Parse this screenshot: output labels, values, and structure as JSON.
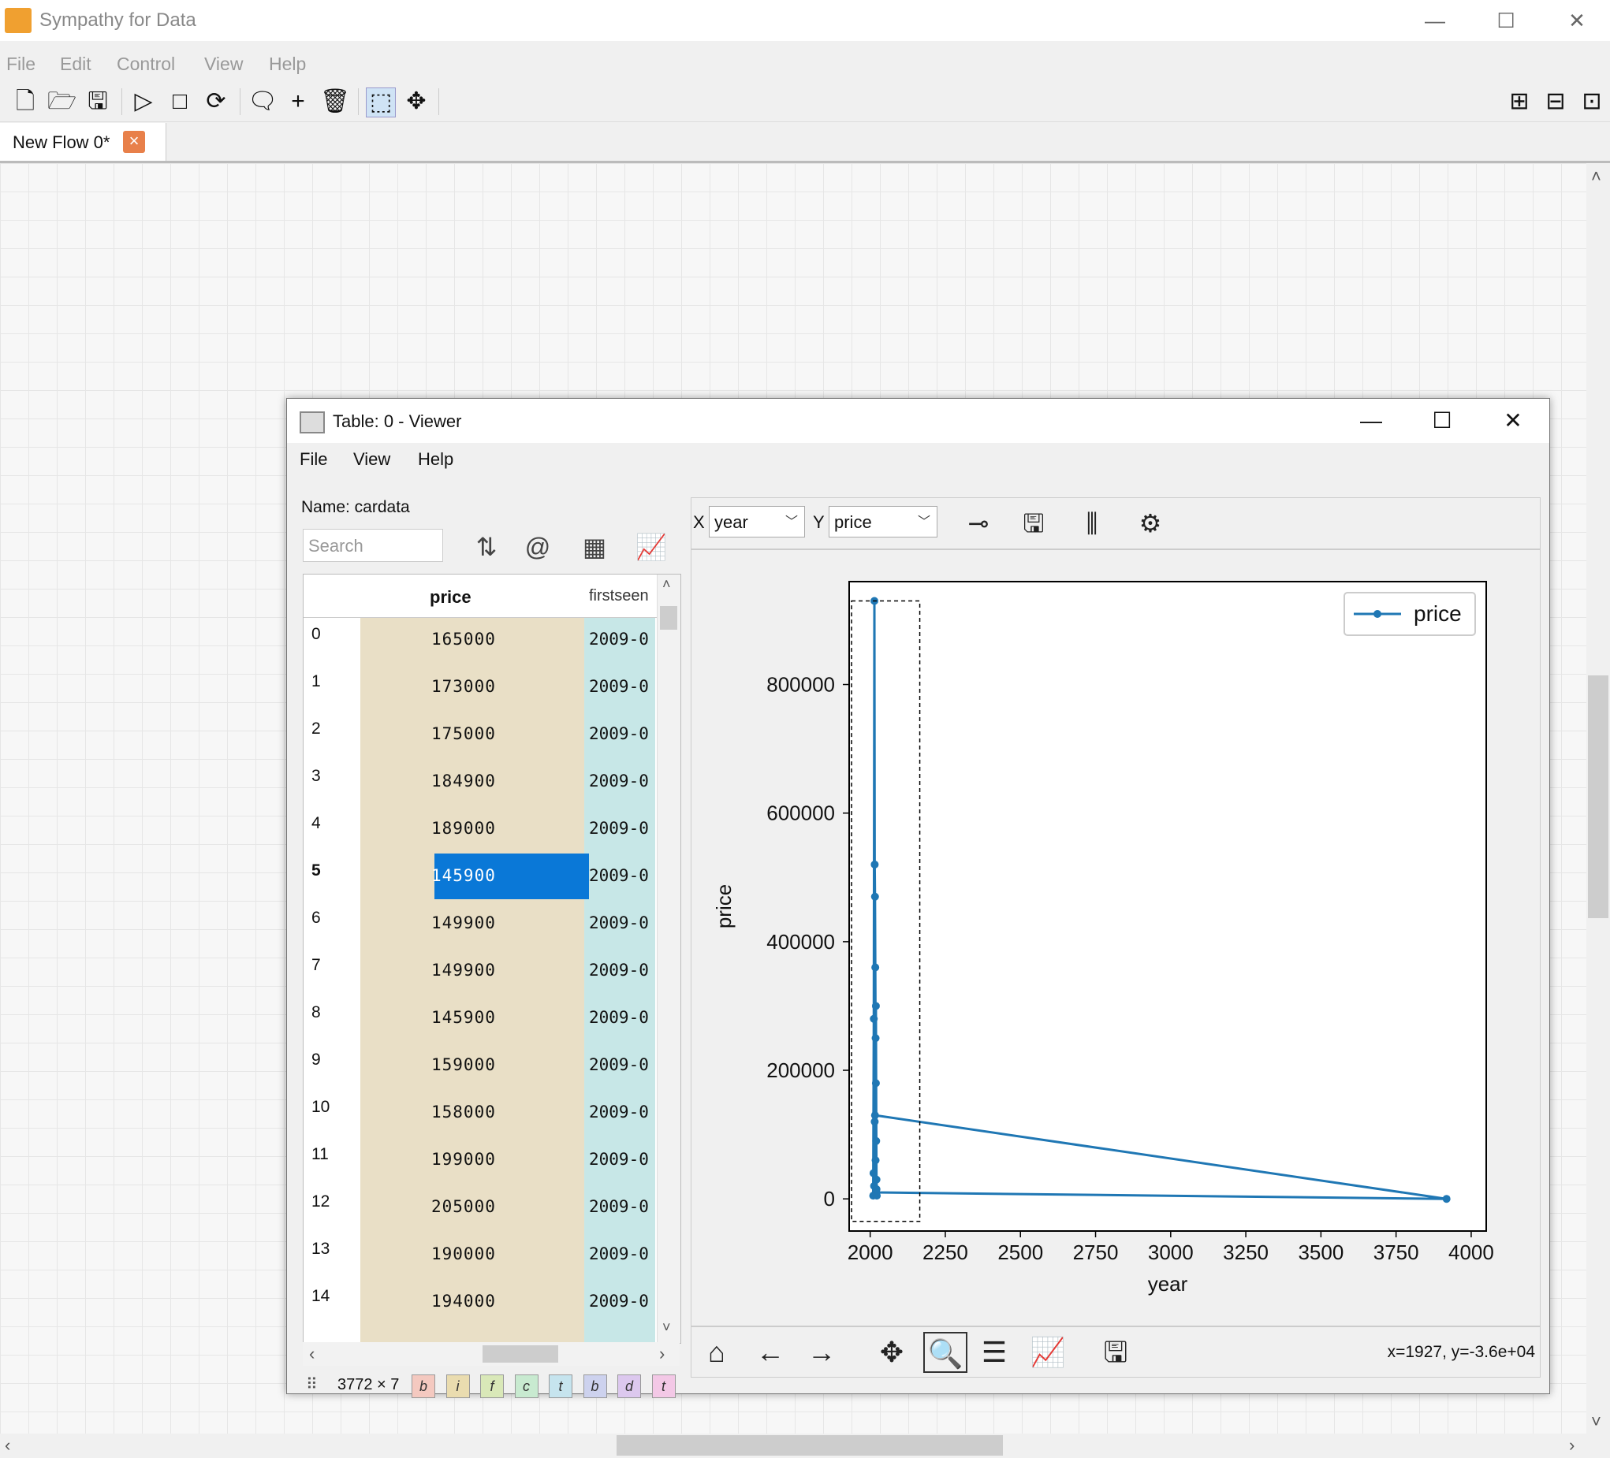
{
  "app": {
    "title": "Sympathy for Data",
    "menus": [
      "File",
      "Edit",
      "Control",
      "View",
      "Help"
    ],
    "tab": {
      "label": "New Flow 0*",
      "close": "×"
    },
    "window_buttons": {
      "minimize": "—",
      "maximize": "☐",
      "close": "✕"
    }
  },
  "viewer": {
    "title": "Table: 0 - Viewer",
    "menus": [
      "File",
      "View",
      "Help"
    ],
    "window_buttons": {
      "minimize": "—",
      "maximize": "☐",
      "close": "✕"
    },
    "name_label": "Name: cardata",
    "search_placeholder": "Search",
    "table": {
      "columns": [
        "price",
        "firstseen"
      ],
      "rows": [
        {
          "index": "0",
          "price": "165000",
          "firstseen": "2009-0"
        },
        {
          "index": "1",
          "price": "173000",
          "firstseen": "2009-0"
        },
        {
          "index": "2",
          "price": "175000",
          "firstseen": "2009-0"
        },
        {
          "index": "3",
          "price": "184900",
          "firstseen": "2009-0"
        },
        {
          "index": "4",
          "price": "189000",
          "firstseen": "2009-0"
        },
        {
          "index": "5",
          "price": "145900",
          "firstseen": "2009-0",
          "selected": true
        },
        {
          "index": "6",
          "price": "149900",
          "firstseen": "2009-0"
        },
        {
          "index": "7",
          "price": "149900",
          "firstseen": "2009-0"
        },
        {
          "index": "8",
          "price": "145900",
          "firstseen": "2009-0"
        },
        {
          "index": "9",
          "price": "159000",
          "firstseen": "2009-0"
        },
        {
          "index": "10",
          "price": "158000",
          "firstseen": "2009-0"
        },
        {
          "index": "11",
          "price": "199000",
          "firstseen": "2009-0"
        },
        {
          "index": "12",
          "price": "205000",
          "firstseen": "2009-0"
        },
        {
          "index": "13",
          "price": "190000",
          "firstseen": "2009-0"
        },
        {
          "index": "14",
          "price": "194000",
          "firstseen": "2009-0"
        }
      ],
      "dimensions": "3772 × 7",
      "column_types": [
        {
          "letter": "b",
          "color": "#f4c9c0"
        },
        {
          "letter": "i",
          "color": "#eadcaf"
        },
        {
          "letter": "f",
          "color": "#d9e8b8"
        },
        {
          "letter": "c",
          "color": "#c8ead0"
        },
        {
          "letter": "t",
          "color": "#c6e4ee"
        },
        {
          "letter": "b",
          "color": "#cdd2ee"
        },
        {
          "letter": "d",
          "color": "#dcc8ee"
        },
        {
          "letter": "t",
          "color": "#f3c8e6"
        }
      ]
    },
    "plot": {
      "x_label": "X",
      "x_value": "year",
      "y_label": "Y",
      "y_value": "price",
      "coords_readout": "x=1927, y=-3.6e+04"
    }
  },
  "colors": {
    "accent": "#0a78d7",
    "series": "#1f77b4"
  },
  "chart_data": {
    "type": "line",
    "xlabel": "year",
    "ylabel": "price",
    "xlim": [
      1930,
      4050
    ],
    "ylim": [
      -50000,
      960000
    ],
    "xticks": [
      2000,
      2250,
      2500,
      2750,
      3000,
      3250,
      3500,
      3750,
      4000
    ],
    "yticks": [
      0,
      200000,
      400000,
      600000,
      800000
    ],
    "legend": {
      "position": "top-right",
      "entries": [
        "price"
      ]
    },
    "series": [
      {
        "name": "price",
        "x": [
          2010,
          2012,
          2014,
          2015,
          2016,
          2017,
          2018,
          2019,
          2020,
          2021,
          2022,
          2015,
          2013,
          2018,
          2020,
          3918,
          2016,
          2011,
          2019,
          2021
        ],
        "y": [
          5000,
          280000,
          930000,
          520000,
          470000,
          360000,
          250000,
          180000,
          90000,
          30000,
          5000,
          120000,
          20000,
          60000,
          10000,
          0,
          130000,
          40000,
          300000,
          15000
        ]
      }
    ]
  }
}
